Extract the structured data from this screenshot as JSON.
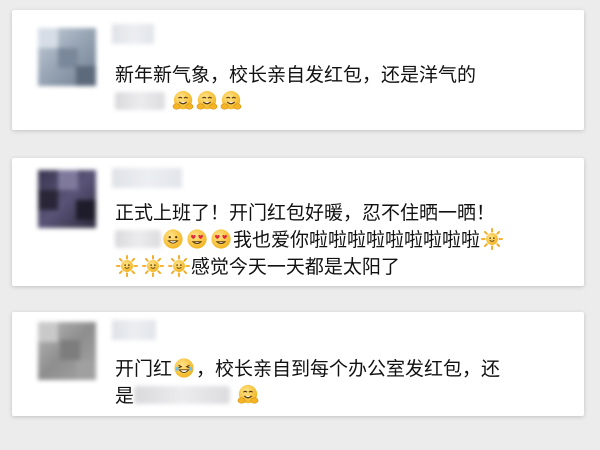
{
  "posts": [
    {
      "line1": "新年新气象，校长亲自发红包，还是洋气的",
      "emojis": [
        "hug-emoji",
        "hug-emoji",
        "hug-emoji"
      ]
    },
    {
      "line1": "正式上班了！开门红包好暖，忍不住晒一晒！",
      "line2_text": "我也爱你啦啦啦啦啦啦啦啦啦",
      "line3_text": "感觉今天一天都是太阳了",
      "emojis": [
        "grin-emoji",
        "heart-eyes-emoji",
        "heart-eyes-emoji",
        "sun-emoji",
        "sun-emoji",
        "sun-emoji",
        "sun-emoji"
      ]
    },
    {
      "line1_a": "开门红",
      "line1_b": "，校长亲自到每个办公室发红包，还",
      "line2_a": "是",
      "emojis": [
        "laugh-emoji",
        "hug-emoji"
      ]
    }
  ],
  "colors": {
    "background": "#ececec",
    "card": "#ffffff",
    "text": "#111111",
    "emoji_yellow": "#f7c62f"
  }
}
